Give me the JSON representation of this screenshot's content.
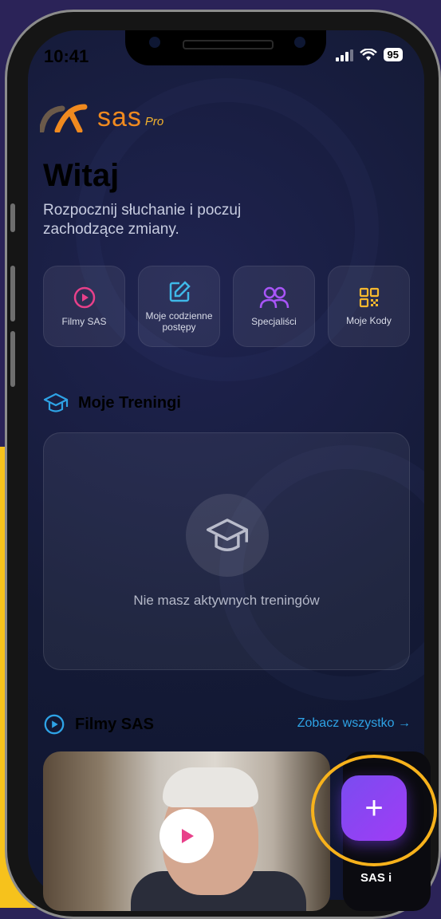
{
  "status_bar": {
    "time": "10:41",
    "battery": "95"
  },
  "brand": {
    "name": "sas",
    "suffix": "Pro"
  },
  "header": {
    "title": "Witaj",
    "subtitle": "Rozpocznij słuchanie i poczuj zachodzące zmiany."
  },
  "quick_actions": [
    {
      "label": "Filmy SAS",
      "icon": "play-circle-icon",
      "color": "#e8408a"
    },
    {
      "label": "Moje codzienne postępy",
      "icon": "edit-icon",
      "color": "#3fb8e8"
    },
    {
      "label": "Specjaliści",
      "icon": "users-icon",
      "color": "#a855f7"
    },
    {
      "label": "Moje Kody",
      "icon": "qr-code-icon",
      "color": "#f5b82e"
    }
  ],
  "trainings": {
    "title": "Moje Treningi",
    "empty_text": "Nie masz aktywnych treningów"
  },
  "films": {
    "title": "Filmy SAS",
    "see_all": "Zobacz wszystko →",
    "items": [
      {
        "caption": ""
      },
      {
        "caption": "SAS i"
      }
    ]
  },
  "colors": {
    "accent_purple": "#8b4cf5",
    "link_blue": "#2ea3e6",
    "highlight_ring": "#f7b21c"
  }
}
